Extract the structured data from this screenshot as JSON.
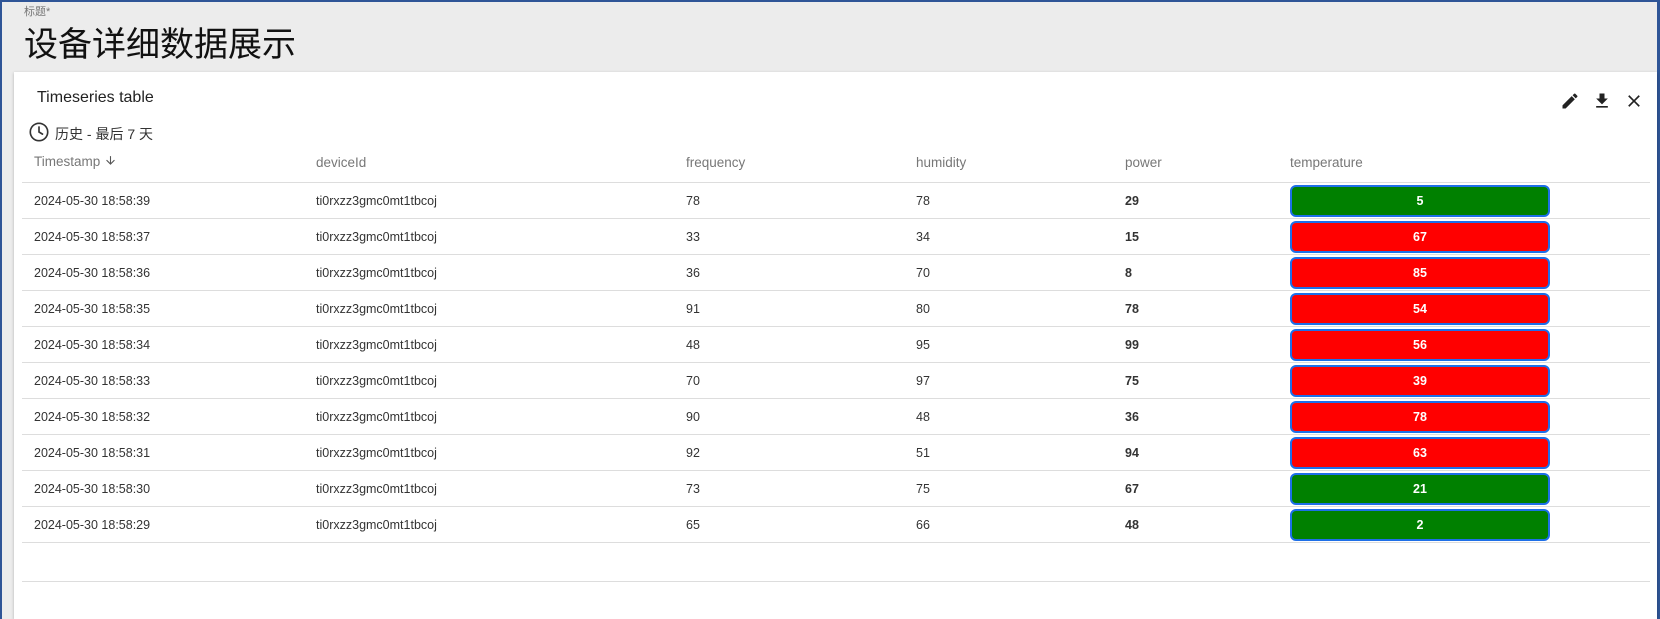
{
  "header": {
    "label": "标题*",
    "title": "设备详细数据展示"
  },
  "widget": {
    "title": "Timeseries table",
    "timewindow": "历史 - 最后 7 天",
    "icons": [
      "clock-icon",
      "edit-icon",
      "download-icon",
      "close-icon"
    ]
  },
  "table": {
    "columns": [
      "Timestamp",
      "deviceId",
      "frequency",
      "humidity",
      "power",
      "temperature"
    ],
    "sort_icon": "arrow-down-icon",
    "rows": [
      {
        "timestamp": "2024-05-30 18:58:39",
        "deviceId": "ti0rxzz3gmc0mt1tbcoj",
        "frequency": "78",
        "humidity": "78",
        "power": "29",
        "power_status": "red",
        "temperature": "5",
        "temp_status": "green"
      },
      {
        "timestamp": "2024-05-30 18:58:37",
        "deviceId": "ti0rxzz3gmc0mt1tbcoj",
        "frequency": "33",
        "humidity": "34",
        "power": "15",
        "power_status": "green",
        "temperature": "67",
        "temp_status": "red"
      },
      {
        "timestamp": "2024-05-30 18:58:36",
        "deviceId": "ti0rxzz3gmc0mt1tbcoj",
        "frequency": "36",
        "humidity": "70",
        "power": "8",
        "power_status": "green",
        "temperature": "85",
        "temp_status": "red"
      },
      {
        "timestamp": "2024-05-30 18:58:35",
        "deviceId": "ti0rxzz3gmc0mt1tbcoj",
        "frequency": "91",
        "humidity": "80",
        "power": "78",
        "power_status": "red",
        "temperature": "54",
        "temp_status": "red"
      },
      {
        "timestamp": "2024-05-30 18:58:34",
        "deviceId": "ti0rxzz3gmc0mt1tbcoj",
        "frequency": "48",
        "humidity": "95",
        "power": "99",
        "power_status": "red",
        "temperature": "56",
        "temp_status": "red"
      },
      {
        "timestamp": "2024-05-30 18:58:33",
        "deviceId": "ti0rxzz3gmc0mt1tbcoj",
        "frequency": "70",
        "humidity": "97",
        "power": "75",
        "power_status": "red",
        "temperature": "39",
        "temp_status": "red"
      },
      {
        "timestamp": "2024-05-30 18:58:32",
        "deviceId": "ti0rxzz3gmc0mt1tbcoj",
        "frequency": "90",
        "humidity": "48",
        "power": "36",
        "power_status": "red",
        "temperature": "78",
        "temp_status": "red"
      },
      {
        "timestamp": "2024-05-30 18:58:31",
        "deviceId": "ti0rxzz3gmc0mt1tbcoj",
        "frequency": "92",
        "humidity": "51",
        "power": "94",
        "power_status": "red",
        "temperature": "63",
        "temp_status": "red"
      },
      {
        "timestamp": "2024-05-30 18:58:30",
        "deviceId": "ti0rxzz3gmc0mt1tbcoj",
        "frequency": "73",
        "humidity": "75",
        "power": "67",
        "power_status": "red",
        "temperature": "21",
        "temp_status": "green"
      },
      {
        "timestamp": "2024-05-30 18:58:29",
        "deviceId": "ti0rxzz3gmc0mt1tbcoj",
        "frequency": "65",
        "humidity": "66",
        "power": "48",
        "power_status": "red",
        "temperature": "2",
        "temp_status": "green"
      }
    ]
  },
  "colors": {
    "red": "#ff0000",
    "green": "#008000",
    "badge_border": "#1e6fe8",
    "accent": "#2f5597"
  }
}
